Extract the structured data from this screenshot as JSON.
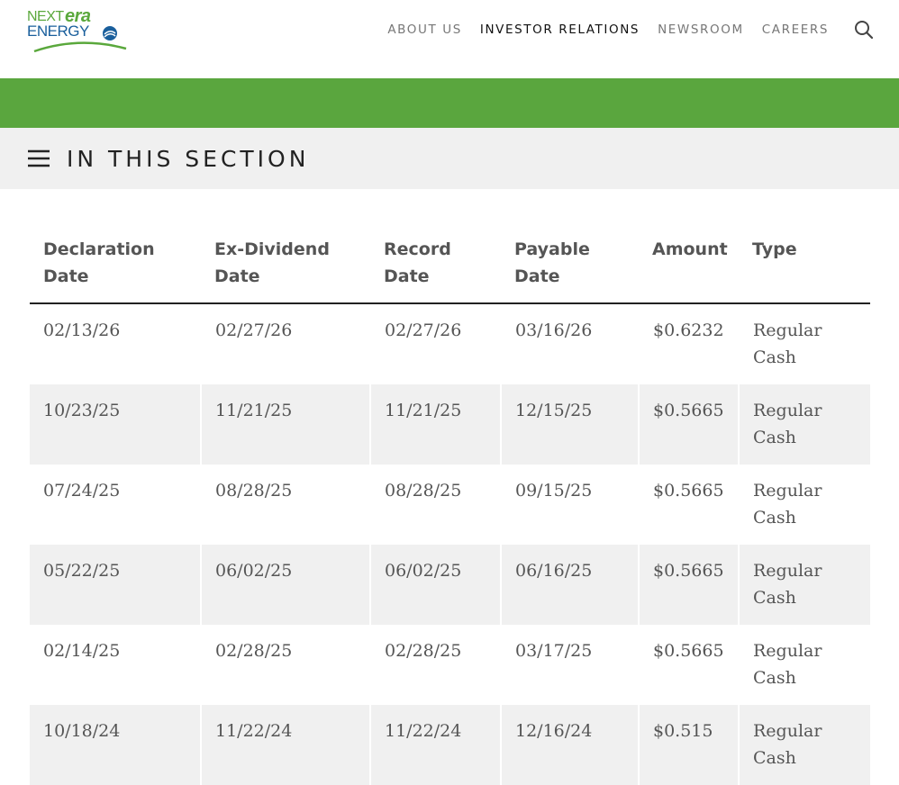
{
  "header": {
    "logo": {
      "next": "NEXT",
      "era": "era",
      "energy": "ENERGY"
    },
    "nav": [
      "ABOUT US",
      "INVESTOR RELATIONS",
      "NEWSROOM",
      "CAREERS"
    ],
    "active_nav": "INVESTOR RELATIONS"
  },
  "colors": {
    "brand_green": "#5aa63e",
    "brand_blue": "#1a5f9c",
    "section_bg": "#f0f0f0"
  },
  "section": {
    "title": "IN THIS SECTION"
  },
  "table": {
    "columns": [
      "Declaration Date",
      "Ex-Dividend Date",
      "Record Date",
      "Payable Date",
      "Amount",
      "Type"
    ],
    "rows": [
      [
        "02/13/26",
        "02/27/26",
        "02/27/26",
        "03/16/26",
        "$0.6232",
        "Regular Cash"
      ],
      [
        "10/23/25",
        "11/21/25",
        "11/21/25",
        "12/15/25",
        "$0.5665",
        "Regular Cash"
      ],
      [
        "07/24/25",
        "08/28/25",
        "08/28/25",
        "09/15/25",
        "$0.5665",
        "Regular Cash"
      ],
      [
        "05/22/25",
        "06/02/25",
        "06/02/25",
        "06/16/25",
        "$0.5665",
        "Regular Cash"
      ],
      [
        "02/14/25",
        "02/28/25",
        "02/28/25",
        "03/17/25",
        "$0.5665",
        "Regular Cash"
      ],
      [
        "10/18/24",
        "11/22/24",
        "11/22/24",
        "12/16/24",
        "$0.515",
        "Regular Cash"
      ]
    ]
  }
}
